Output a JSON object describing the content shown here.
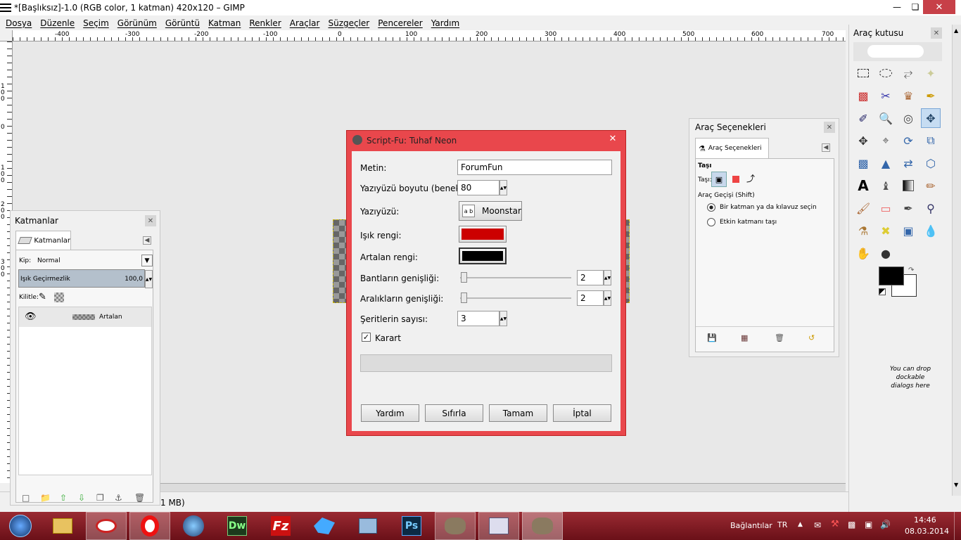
{
  "window": {
    "title": "*[Başlıksız]-1.0 (RGB color, 1 katman) 420x120 – GIMP"
  },
  "menu": [
    "Dosya",
    "Düzenle",
    "Seçim",
    "Görünüm",
    "Görüntü",
    "Katman",
    "Renkler",
    "Araçlar",
    "Süzgeçler",
    "Pencereler",
    "Yardım"
  ],
  "ruler_labels": [
    "-400",
    "-300",
    "-200",
    "-100",
    "0",
    "100",
    "200",
    "300",
    "400",
    "500",
    "600",
    "700"
  ],
  "vruler_labels": [
    "1 0 0",
    "0",
    "1 0 0",
    "2 0 0",
    "3 0 0"
  ],
  "status": {
    "memory": "1 MB)"
  },
  "layers_panel": {
    "title": "Katmanlar",
    "tab": "Katmanlar",
    "mode_label": "Kip:",
    "mode_value": "Normal",
    "opacity_label": "Işık Geçirmezlik",
    "opacity_value": "100,0",
    "lock_label": "Kilitle:",
    "layer_name": "Artalan"
  },
  "dialog": {
    "title": "Script-Fu: Tuhaf Neon",
    "text_label": "Metin:",
    "text_value": "ForumFun",
    "size_label": "Yazıyüzü boyutu (benek):",
    "size_value": "80",
    "font_label": "Yazıyüzü:",
    "font_value": "Moonstar",
    "glow_label": "Işık rengi:",
    "glow_color": "#cc0000",
    "bg_label": "Artalan rengi:",
    "bg_color": "#000000",
    "band_label": "Bantların genişliği:",
    "band_value": "2",
    "gap_label": "Aralıkların genişliği:",
    "gap_value": "2",
    "strip_label": "Şeritlerin sayısı:",
    "strip_value": "3",
    "fade_label": "Karart",
    "fade_checked": true,
    "btn_help": "Yardım",
    "btn_reset": "Sıfırla",
    "btn_ok": "Tamam",
    "btn_cancel": "İptal"
  },
  "tool_options": {
    "title": "Araç Seçenekleri",
    "tab": "Araç Seçenekleri",
    "tool_name": "Taşı",
    "move_label": "Taşı:",
    "toggle_label": "Araç Geçişi  (Shift)",
    "radio1": "Bir katman ya da kılavuz seçin",
    "radio2": "Etkin katmanı taşı"
  },
  "toolbox": {
    "title": "Araç kutusu",
    "drop_hint": "You can drop dockable dialogs here",
    "fg_color": "#000000",
    "bg_color": "#ffffff"
  },
  "taskbar": {
    "bag_label": "Bağlantılar",
    "lang": "TR",
    "time": "14:46",
    "date": "08.03.2014"
  }
}
